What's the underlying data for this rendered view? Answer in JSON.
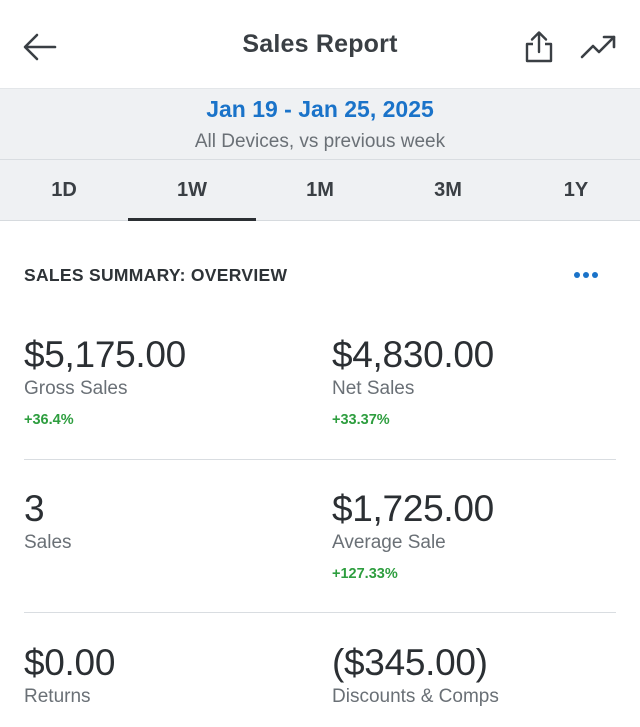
{
  "header": {
    "title": "Sales Report",
    "back_icon": "arrow-left-icon",
    "share_icon": "share-icon",
    "trend_icon": "trending-up-icon"
  },
  "date": {
    "range": "Jan 19 - Jan 25, 2025",
    "subtitle": "All Devices, vs previous week"
  },
  "tabs": [
    {
      "label": "1D",
      "active": false
    },
    {
      "label": "1W",
      "active": true
    },
    {
      "label": "1M",
      "active": false
    },
    {
      "label": "3M",
      "active": false
    },
    {
      "label": "1Y",
      "active": false
    }
  ],
  "summary": {
    "title": "SALES SUMMARY: OVERVIEW",
    "more_icon": "more-horizontal-icon",
    "metrics": [
      {
        "value": "$5,175.00",
        "label": "Gross Sales",
        "change": "+36.4%"
      },
      {
        "value": "$4,830.00",
        "label": "Net Sales",
        "change": "+33.37%"
      },
      {
        "value": "3",
        "label": "Sales",
        "change": ""
      },
      {
        "value": "$1,725.00",
        "label": "Average Sale",
        "change": "+127.33%"
      },
      {
        "value": "$0.00",
        "label": "Returns",
        "change": ""
      },
      {
        "value": "($345.00)",
        "label": "Discounts & Comps",
        "change": ""
      }
    ]
  },
  "colors": {
    "accent": "#1a73c9",
    "positive": "#2e9e3f",
    "band": "#eff1f3"
  }
}
